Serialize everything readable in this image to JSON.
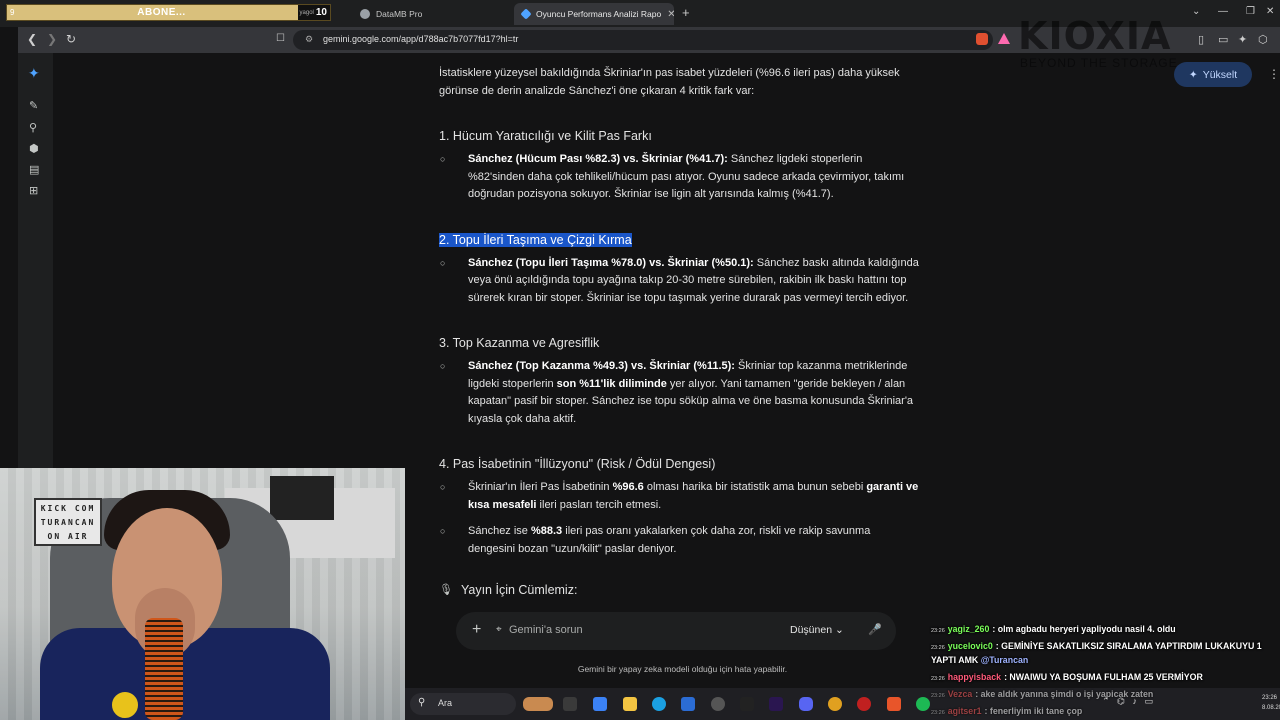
{
  "tabs": {
    "abone_left": "9",
    "abone_label": "ABONE...",
    "abone_small": "yagol",
    "abone_count": "10",
    "tab2_title": "DataMB Pro",
    "tab3_title": "Oyuncu Performans Analizi Rapo",
    "new_tab": "+"
  },
  "address": {
    "url": "gemini.google.com/app/d788ac7b7077fd17?hl=tr"
  },
  "watermark": {
    "brand": "KIOXIA",
    "sub": "BEYOND THE STORAGE"
  },
  "header": {
    "upgrade_label": "Yükselt"
  },
  "content": {
    "intro": "İstatisklere yüzeysel bakıldığında Škriniar'ın pas isabet yüzdeleri (%96.6 ileri pas) daha yüksek görünse de derin analizde Sánchez'i öne çıkaran 4 kritik fark var:",
    "s1_title": "1. Hücum Yaratıcılığı ve Kilit Pas Farkı",
    "s1_b1_bold": "Sánchez (Hücum Pası %82.3) vs. Škriniar (%41.7):",
    "s1_b1_text": " Sánchez ligdeki stoperlerin %82'sinden daha çok tehlikeli/hücum pası atıyor. Oyunu sadece arkada çevirmiyor, takımı doğrudan pozisyona sokuyor. Škriniar ise ligin alt yarısında kalmış (%41.7).",
    "s2_title": "2. Topu İleri Taşıma ve Çizgi Kırma",
    "s2_b1_bold": "Sánchez (Topu İleri Taşıma %78.0) vs. Škriniar (%50.1):",
    "s2_b1_text": " Sánchez baskı altında kaldığında veya önü açıldığında topu ayağına takıp 20-30 metre sürebilen, rakibin ilk baskı hattını top sürerek kıran bir stoper. Škriniar ise topu taşımak yerine durarak pas vermeyi tercih ediyor.",
    "s3_title": "3. Top Kazanma ve Agresiflik",
    "s3_b1_bold": "Sánchez (Top Kazanma %49.3) vs. Škriniar (%11.5):",
    "s3_b1_text_a": " Škriniar top kazanma metriklerinde ligdeki stoperlerin ",
    "s3_b1_bold2": "son %11'lik diliminde",
    "s3_b1_text_b": " yer alıyor. Yani tamamen \"geride bekleyen / alan kapatan\" pasif bir stoper. Sánchez ise topu söküp alma ve öne basma konusunda Škriniar'a kıyasla çok daha aktif.",
    "s4_title": "4. Pas İsabetinin \"İllüzyonu\" (Risk / Ödül Dengesi)",
    "s4_b1_text_a": "Škriniar'ın İleri Pas İsabetinin ",
    "s4_b1_bold": "%96.6",
    "s4_b1_text_b": " olması harika bir istatistik ama bunun sebebi ",
    "s4_b1_bold2": "garanti ve kısa mesafeli",
    "s4_b1_text_c": " ileri pasları tercih etmesi.",
    "s4_b2_text_a": "Sánchez ise ",
    "s4_b2_bold": "%88.3",
    "s4_b2_text_b": " ileri pas oranı yakalarken çok daha zor, riskli ve rakip savunma dengesini bozan \"uzun/kilit\" paslar deniyor.",
    "yayin_title": "Yayın İçin Cümlemiz:"
  },
  "prompt": {
    "placeholder": "Gemini'a sorun",
    "mode": "Düşünen",
    "disclaimer": "Gemini bir yapay zeka modeli olduğu için hata yapabilir."
  },
  "webcam": {
    "sign_l1": "KICK COM",
    "sign_l2": "TURANCAN",
    "sign_l3": "ON AIR"
  },
  "taskbar": {
    "search": "Ara"
  },
  "chat": [
    {
      "time": "23:26",
      "user": "yagiz_260",
      "user_color": "#7bff5a",
      "text": ": olm agbadu heryeri yapliyodu nasil 4. oldu",
      "mention": ""
    },
    {
      "time": "23:26",
      "user": "yucelovic0",
      "user_color": "#7bff5a",
      "text": ": GEMİNİYE SAKATLIKSIZ SIRALAMA YAPTIRDIM LUKAKUYU 1 YAPTI AMK ",
      "mention": "@Turancan"
    },
    {
      "time": "23:26",
      "user": "happyisback",
      "user_color": "#ff5a7a",
      "text": ": NWAIWU YA BOŞUMA FULHAM 25 VERMİYOR",
      "mention": ""
    },
    {
      "time": "23:26",
      "user": "Vezca",
      "user_color": "#ff5a5a",
      "text": ": ake aldık yanına şimdi o işi yapicak zaten",
      "mention": ""
    },
    {
      "time": "23:26",
      "user": "agitser1",
      "user_color": "#ff5a5a",
      "text": ": fenerliyim iki tane çop",
      "mention": ""
    }
  ],
  "clock": {
    "time": "23:26",
    "date": "8.08.20"
  }
}
